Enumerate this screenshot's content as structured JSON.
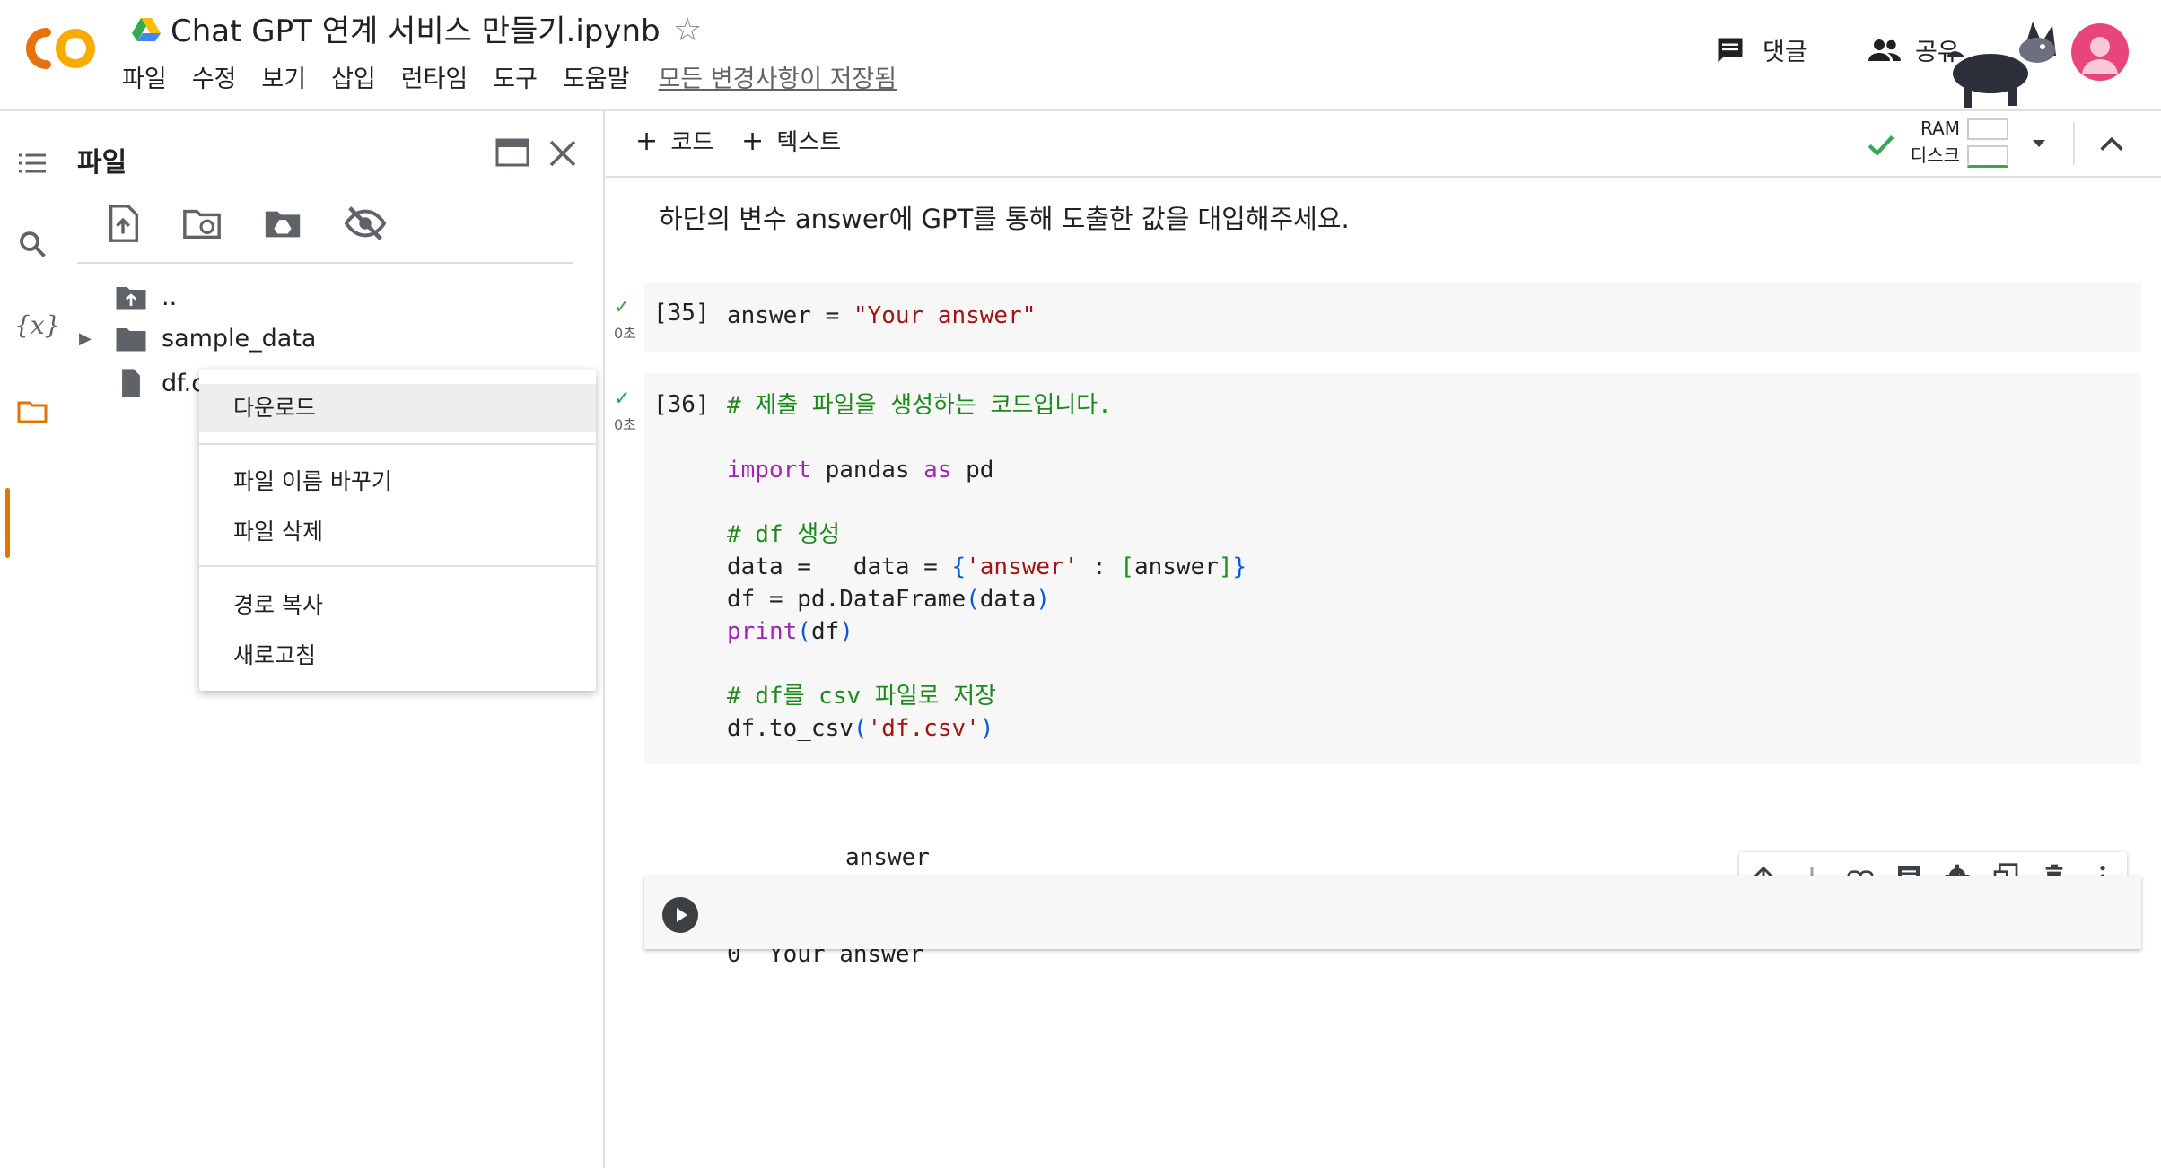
{
  "header": {
    "doc_title": "Chat GPT 연계 서비스 만들기.ipynb",
    "menu": [
      "파일",
      "수정",
      "보기",
      "삽입",
      "런타임",
      "도구",
      "도움말"
    ],
    "save_status": "모든 변경사항이 저장됨",
    "comment_label": "댓글",
    "share_label": "공유"
  },
  "files_panel": {
    "title": "파일",
    "tree": [
      {
        "name": "..",
        "icon": "folder-up-icon"
      },
      {
        "name": "sample_data",
        "icon": "folder-icon"
      },
      {
        "name": "df.c",
        "icon": "file-icon"
      }
    ]
  },
  "context_menu": {
    "items": [
      "다운로드",
      "파일 이름 바꾸기",
      "파일 삭제",
      "경로 복사",
      "새로고침"
    ]
  },
  "toolbar": {
    "add_code": "코드",
    "add_text": "텍스트",
    "ram_label": "RAM",
    "disk_label": "디스크"
  },
  "notebook": {
    "text_cell": "하단의 변수 answer에 GPT를 통해 도출한 값을 대입해주세요.",
    "cell35": {
      "count": "[35]",
      "time": "0초"
    },
    "cell36": {
      "count": "[36]",
      "time": "0초"
    },
    "output_header": "answer",
    "output_row": "0  Your answer"
  },
  "colors": {
    "accent_orange": "#e37400",
    "check_green": "#34a853",
    "keyword": "#9c27b0",
    "string": "#a31515",
    "comment": "#1e8a1e"
  }
}
